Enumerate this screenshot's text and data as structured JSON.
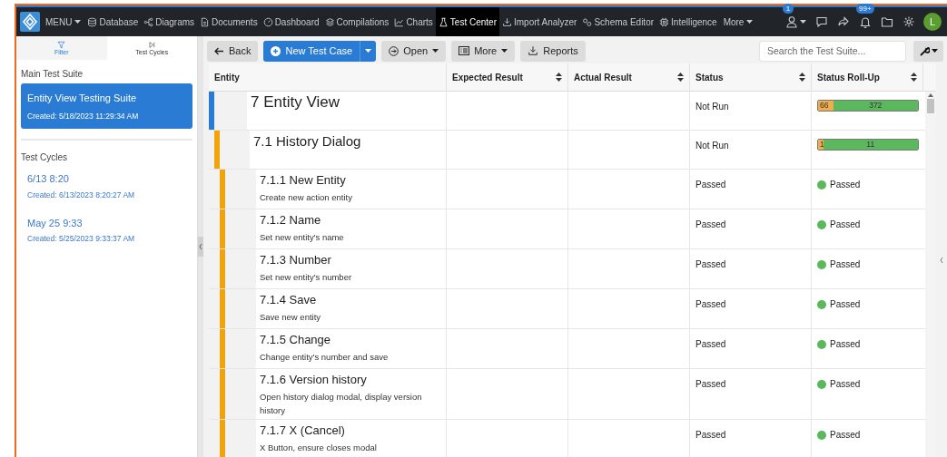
{
  "nav": {
    "menu": "MENU",
    "items": [
      {
        "label": "Database",
        "selected": false
      },
      {
        "label": "Diagrams",
        "selected": false
      },
      {
        "label": "Documents",
        "selected": false
      },
      {
        "label": "Dashboard",
        "selected": false
      },
      {
        "label": "Compilations",
        "selected": false
      },
      {
        "label": "Charts",
        "selected": false
      },
      {
        "label": "Test Center",
        "selected": true
      },
      {
        "label": "Import Analyzer",
        "selected": false
      },
      {
        "label": "Schema Editor",
        "selected": false
      },
      {
        "label": "Intelligence",
        "selected": false
      }
    ],
    "more": "More",
    "tool_badges": [
      {
        "label": "1"
      },
      {
        "label": "99+"
      }
    ],
    "avatar": "L"
  },
  "sidebar": {
    "tabs": [
      {
        "label": "Filter",
        "selected": false
      },
      {
        "label": "Test Cycles",
        "selected": true
      }
    ],
    "main_heading": "Main Test Suite",
    "suite": {
      "name": "Entity View Testing Suite",
      "created": "Created: 5/18/2023 11:29:34 AM",
      "selected": true
    },
    "cycles_heading": "Test Cycles",
    "cycles": [
      {
        "name": "6/13 8:20",
        "created": "Created: 6/13/2023 8:20:27 AM"
      },
      {
        "name": "May 25 9:33",
        "created": "Created: 5/25/2023 9:33:37 AM"
      }
    ]
  },
  "toolbar": {
    "back": "Back",
    "new": "New Test Case",
    "open": "Open",
    "more": "More",
    "reports": "Reports",
    "search_placeholder": "Search the Test Suite..."
  },
  "table": {
    "columns": [
      "Entity",
      "Expected Result",
      "Actual Result",
      "Status",
      "Status Roll-Up"
    ],
    "rows": [
      {
        "title": "7 Entity View",
        "status": "Not Run",
        "color": "#2a7bd4",
        "rollup": [
          {
            "label": "66",
            "color": "#f0ad4e",
            "level": 0.15
          },
          {
            "label": "372",
            "color": "#5cb85c",
            "level": 0.85
          }
        ],
        "children": [
          {
            "title": "7.1 History Dialog",
            "status": "Not Run",
            "color": "#f0a30a",
            "rollup": [
              {
                "label": "1",
                "color": "#f0ad4e",
                "level": 0.05
              },
              {
                "label": "11",
                "color": "#5cb85c",
                "level": 0.95
              }
            ],
            "children": [
              {
                "title": "7.1.1 New Entity",
                "description": "Create new action entity",
                "status": "Passed",
                "color": "#f0a30a",
                "result": {
                  "label": "Passed",
                  "color": "#5cb85c"
                }
              },
              {
                "title": "7.1.2 Name",
                "description": "Set new entity's name",
                "status": "Passed",
                "color": "#f0a30a",
                "result": {
                  "label": "Passed",
                  "color": "#5cb85c"
                }
              },
              {
                "title": "7.1.3 Number",
                "description": "Set new entity's number",
                "status": "Passed",
                "color": "#f0a30a",
                "result": {
                  "label": "Passed",
                  "color": "#5cb85c"
                }
              },
              {
                "title": "7.1.4 Save",
                "description": "Save new entity",
                "status": "Passed",
                "color": "#f0a30a",
                "result": {
                  "label": "Passed",
                  "color": "#5cb85c"
                }
              },
              {
                "title": "7.1.5 Change",
                "description": "Change entity's number and save",
                "status": "Passed",
                "color": "#f0a30a",
                "result": {
                  "label": "Passed",
                  "color": "#5cb85c"
                }
              },
              {
                "title": "7.1.6 Version history",
                "description": "Open history dialog modal, display version history",
                "status": "Passed",
                "color": "#f0a30a",
                "result": {
                  "label": "Passed",
                  "color": "#5cb85c"
                }
              },
              {
                "title": "7.1.7 X (Cancel)",
                "description": "X Button, ensure closes modal",
                "status": "Passed",
                "color": "#f0a30a",
                "result": {
                  "label": "Passed",
                  "color": "#5cb85c"
                }
              }
            ]
          }
        ]
      }
    ]
  }
}
